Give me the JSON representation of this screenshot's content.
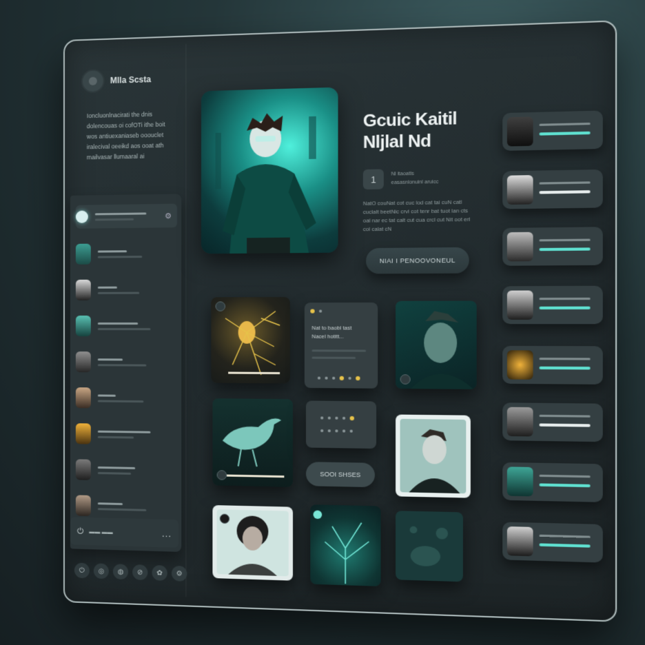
{
  "sidebar": {
    "profile_name": "Mlla Scsta",
    "intro_lines": [
      "Ioncluonlnacirati the dnis",
      "dolencouas oi cofOTi ithe boit",
      "wos antiuexaniaseb ooouclet",
      "iralecival oeeikd aos ooat ath",
      "mailvasar llumaaral ai"
    ],
    "footer_more": "...",
    "footer_icons": [
      "power-icon",
      "globe-icon",
      "chat-icon",
      "link-icon",
      "leaf-icon",
      "gear-icon"
    ]
  },
  "hero": {
    "title_line1": "Gcuic Kaitil",
    "title_line2": "Nljlal Nd",
    "number": "1",
    "meta_line1": "Nl itaoatls",
    "meta_line2": "easasnlonuinl aruicc",
    "description": "NatO couNat cot cuc lod cat tai cuN catl cuclalt beetNic crvi cot tenr bat tuot lan cts oal nar ec tat calt cut cua crcl cut Nit oot erl col calat cN",
    "cta_label": "NIAI I PENOOVONEUL"
  },
  "grid": {
    "card_text_line1": "Nat to baobl tast",
    "card_text_line2": "Nacel hotitt...",
    "pill_label": "SOOI SHSES"
  },
  "colors": {
    "accent": "#5fe0d0",
    "gold": "#e6c24a",
    "panel": "#2b3538"
  }
}
